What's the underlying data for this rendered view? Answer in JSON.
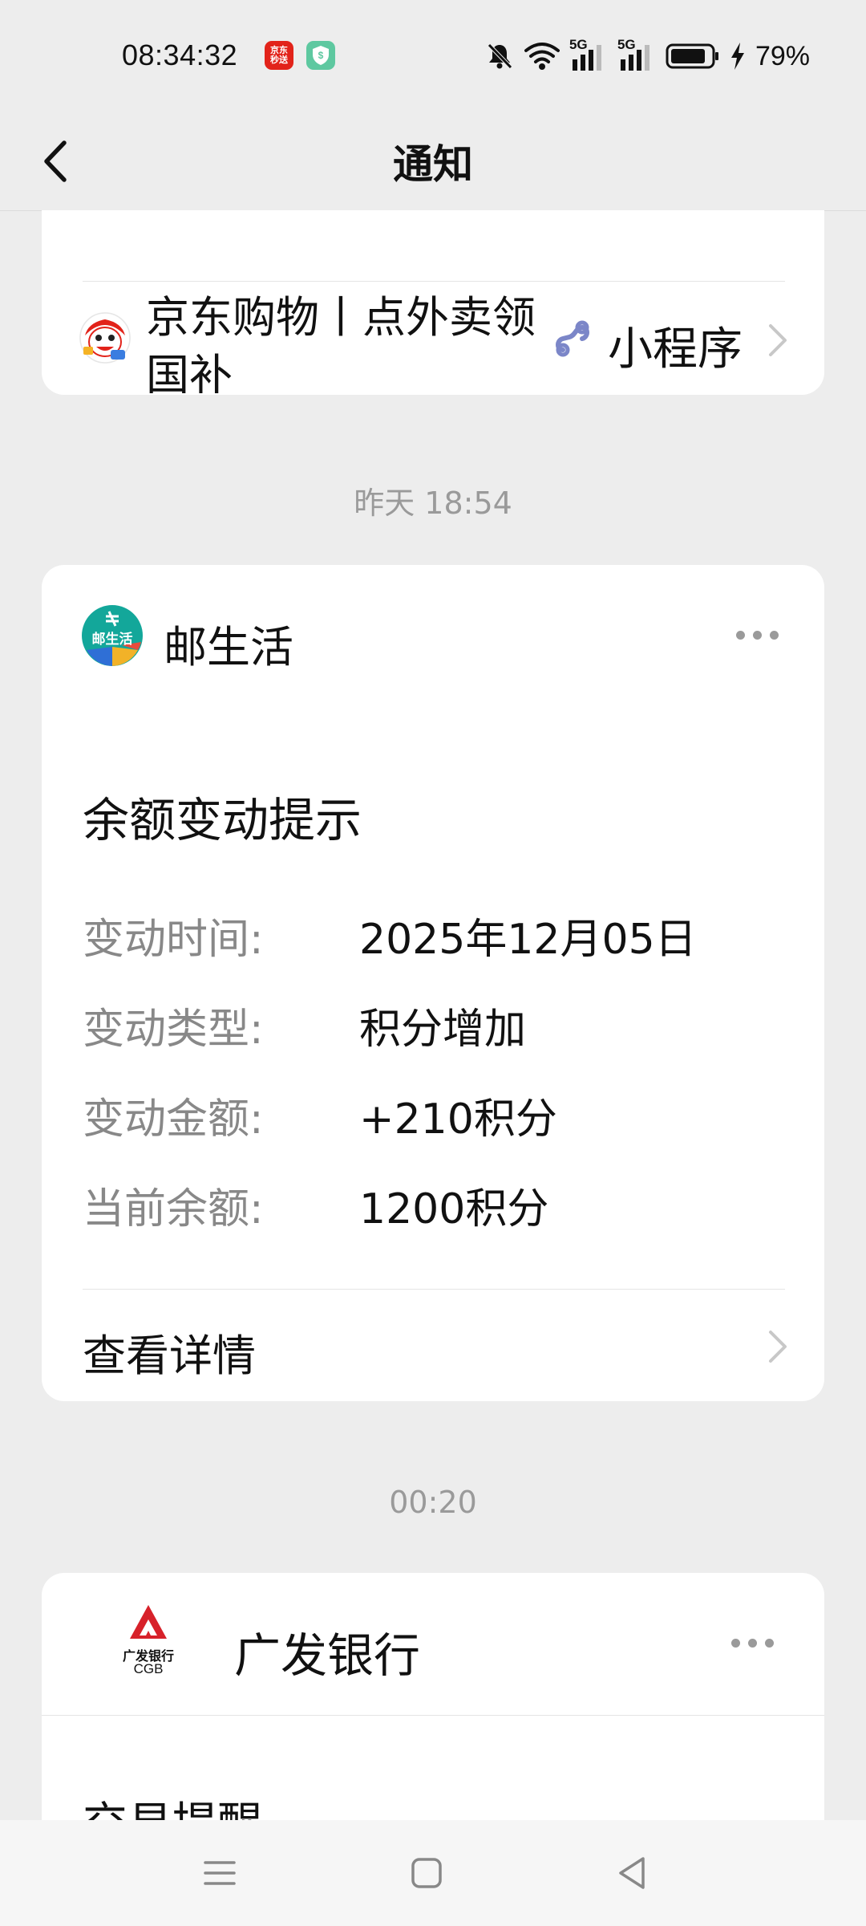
{
  "status_bar": {
    "time": "08:34:32",
    "app_icon_jd_text": "京东\n秒送",
    "battery_percent": "79%",
    "network_5g_label": "5G"
  },
  "nav": {
    "title": "通知"
  },
  "mini_program_card": {
    "name": "京东购物丨点外卖领国补",
    "tag": "小程序"
  },
  "timestamps": {
    "first": "昨天 18:54",
    "second": "00:20"
  },
  "notice_card": {
    "account_name": "邮生活",
    "logo_text": "邮生活",
    "title": "余额变动提示",
    "rows": [
      {
        "label": "变动时间:",
        "value": "2025年12月05日"
      },
      {
        "label": "变动类型:",
        "value": "积分增加"
      },
      {
        "label": "变动金额:",
        "value": "+210积分"
      },
      {
        "label": "当前余额:",
        "value": "1200积分"
      }
    ],
    "view_details": "查看详情"
  },
  "bank_card": {
    "account_name": "广发银行",
    "logo_text_cn": "广发银行",
    "logo_text_en": "CGB",
    "section_title": "交易提醒"
  },
  "colors": {
    "background": "#ededed",
    "card": "#ffffff",
    "label_gray": "#888888",
    "timestamp_gray": "#9a9a9a",
    "mini_program_link": "#7b86c8",
    "cgb_red": "#d7212a",
    "youshenghuo_teal": "#13a79a"
  }
}
